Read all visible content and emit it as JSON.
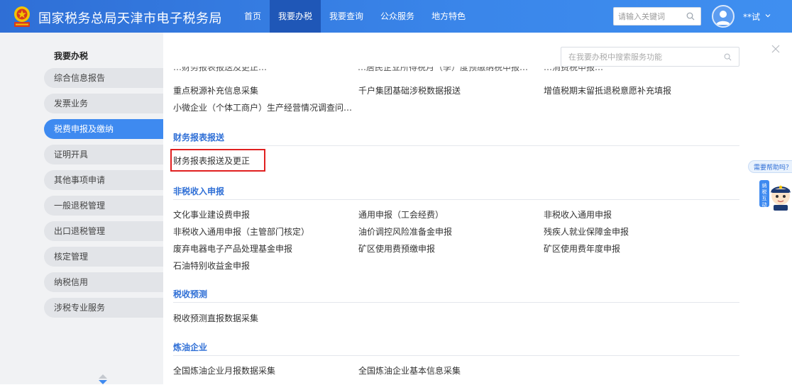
{
  "header": {
    "site_title": "国家税务总局天津市电子税务局",
    "nav": [
      "首页",
      "我要办税",
      "我要查询",
      "公众服务",
      "地方特色"
    ],
    "active_nav": "我要办税",
    "search_placeholder": "请输入关键词",
    "username": "**试"
  },
  "sidebar": {
    "title": "我要办税",
    "items": [
      "综合信息报告",
      "发票业务",
      "税费申报及缴纳",
      "证明开具",
      "其他事项申请",
      "一般退税管理",
      "出口退税管理",
      "核定管理",
      "纳税信用",
      "涉税专业服务"
    ],
    "active_item": "税费申报及缴纳"
  },
  "main": {
    "search_placeholder": "在我要办税中搜索服务功能",
    "partial_top": [
      "…财务报表报送及更正…",
      "…居民企业所得税月（季）度预缴纳税申报…",
      "…消费税申报…"
    ],
    "top_rows": [
      [
        "重点税源补充信息采集",
        "千户集团基础涉税数据报送",
        "增值税期末留抵退税意愿补充填报"
      ],
      [
        "小微企业（个体工商户）生产经营情况调查问…",
        "",
        ""
      ]
    ],
    "sections": [
      {
        "title": "财务报表报送",
        "rows": [
          [
            "财务报表报送及更正",
            "",
            ""
          ]
        ]
      },
      {
        "title": "非税收入申报",
        "rows": [
          [
            "文化事业建设费申报",
            "通用申报（工会经费）",
            "非税收入通用申报"
          ],
          [
            "非税收入通用申报（主管部门核定）",
            "油价调控风险准备金申报",
            "残疾人就业保障金申报"
          ],
          [
            "废弃电器电子产品处理基金申报",
            "矿区使用费预缴申报",
            "矿区使用费年度申报"
          ],
          [
            "石油特别收益金申报",
            "",
            ""
          ]
        ]
      },
      {
        "title": "税收预测",
        "rows": [
          [
            "税收预测直报数据采集",
            "",
            ""
          ]
        ]
      },
      {
        "title": "炼油企业",
        "rows": [
          [
            "全国炼油企业月报数据采集",
            "全国炼油企业基本信息采集",
            ""
          ]
        ]
      }
    ]
  },
  "help": {
    "label": "需要帮助吗？",
    "mascot_text": "纳税互动"
  },
  "colors": {
    "header_blue": "#3a86ea",
    "active_nav": "#1f57b7",
    "sidebar_active": "#3e8af0",
    "section_title": "#2f6fd6",
    "highlight_border": "#e02020"
  }
}
